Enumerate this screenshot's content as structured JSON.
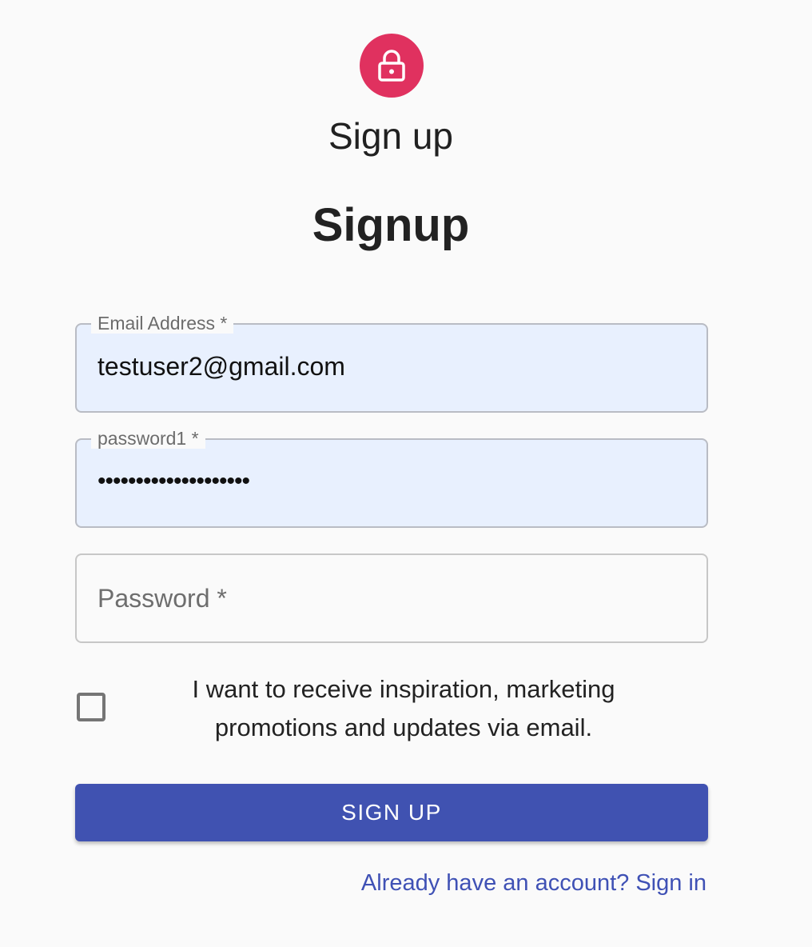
{
  "header": {
    "icon": "lock-icon",
    "subtitle": "Sign up",
    "title": "Signup"
  },
  "form": {
    "email": {
      "label": "Email Address *",
      "value": "testuser2@gmail.com"
    },
    "password1": {
      "label": "password1 *",
      "masked_value": "••••••••••••••••••••"
    },
    "password": {
      "placeholder": "Password *"
    },
    "consent": {
      "checked": false,
      "label": "I want to receive inspiration, marketing promotions and updates via email."
    },
    "submit_label": "SIGN UP",
    "signin_link": "Already have an account? Sign in"
  },
  "colors": {
    "avatar": "#e0315f",
    "primary": "#4052b1",
    "autofill_background": "#e8f0fe",
    "page_background": "#fafafa"
  }
}
